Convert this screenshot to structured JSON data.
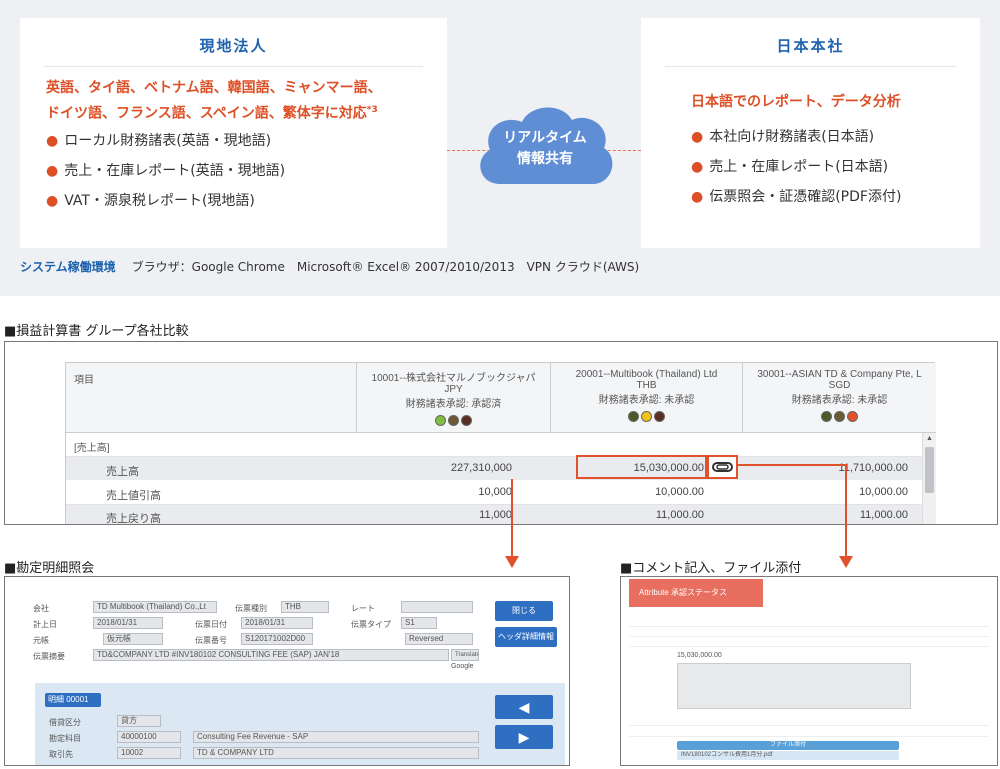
{
  "local": {
    "title": "現地法人",
    "headline_1": "英語、タイ語、ベトナム語、韓国語、ミャンマー語、",
    "headline_2": "ドイツ語、フランス語、スペイン語、繁体字に対応",
    "headline_note": "*3",
    "bullets": [
      "ローカル財務諸表(英語・現地語)",
      "売上・在庫レポート(英語・現地語)",
      "VAT・源泉税レポート(現地語)"
    ]
  },
  "center": {
    "line_1": "リアルタイム",
    "line_2": "情報共有"
  },
  "hq": {
    "title": "日本本社",
    "headline": "日本語でのレポート、データ分析",
    "bullets": [
      "本社向け財務諸表(日本語)",
      "売上・在庫レポート(日本語)",
      "伝票照会・証憑確認(PDF添付)"
    ]
  },
  "env": {
    "label": "システム稼働環境",
    "value": "ブラウザ：Google Chrome　Microsoft® Excel® 2007/2010/2013　VPN クラウド(AWS)"
  },
  "section1": "■損益計算書 グループ各社比較",
  "section2": "■勘定明細照会",
  "section3": "■コメント記入、ファイル添付",
  "grid": {
    "col0": "項目",
    "companies": [
      {
        "name": "10001--株式会社マルノブックジャパ",
        "ccy": "JPY",
        "status": "財務諸表承認: 承認済"
      },
      {
        "name": "20001--Multibook (Thailand) Ltd",
        "ccy": "THB",
        "status": "財務諸表承認: 未承認"
      },
      {
        "name": "30001--ASIAN TD & Company Pte, L",
        "ccy": "SGD",
        "status": "財務諸表承認: 未承認"
      }
    ],
    "group": "[売上高]",
    "rows": [
      {
        "label": "売上高",
        "v": [
          "227,310,000",
          "15,030,000.00",
          "11,710,000.00"
        ]
      },
      {
        "label": "売上値引高",
        "v": [
          "10,000",
          "10,000.00",
          "10,000.00"
        ]
      },
      {
        "label": "売上戻り高",
        "v": [
          "11,000",
          "11,000.00",
          "11,000.00"
        ]
      }
    ]
  },
  "detail": {
    "labels": [
      "会社",
      "計上日",
      "元帳",
      "伝票摘要"
    ],
    "company": "TD Multibook (Thailand) Co.,Lt",
    "date": "2018/01/31",
    "ledger": "仮元帳",
    "memo": "TD&COMPANY LTD #INV180102 CONSULTING FEE (SAP) JAN'18",
    "label_b": [
      "伝票種別",
      "伝票日付",
      "伝票番号"
    ],
    "doc_type": "THB",
    "doc_date": "2018/01/31",
    "doc_no": "S120171002D00",
    "label_c": [
      "レート",
      "伝票タイプ"
    ],
    "type_val": "S1",
    "reversed": "Reversed",
    "btn1": "閉じる",
    "btn2": "ヘッダ詳細情報",
    "translate": "Translate",
    "google": "Google",
    "row_label": "明細",
    "row_no": "00001",
    "row_field_labels": [
      "借貸区分",
      "勘定科目",
      "取引先"
    ],
    "dc": "貸方",
    "account": "40000100",
    "account_name": "Consulting Fee Revenue - SAP",
    "partner": "10002",
    "partner_name": "TD & COMPANY LTD"
  },
  "comment": {
    "header": "Attribute 承認ステータス",
    "amount": "15,030,000.00",
    "button": "ファイル添付",
    "file": "INV180102コンサル費用1月分.pdf"
  }
}
